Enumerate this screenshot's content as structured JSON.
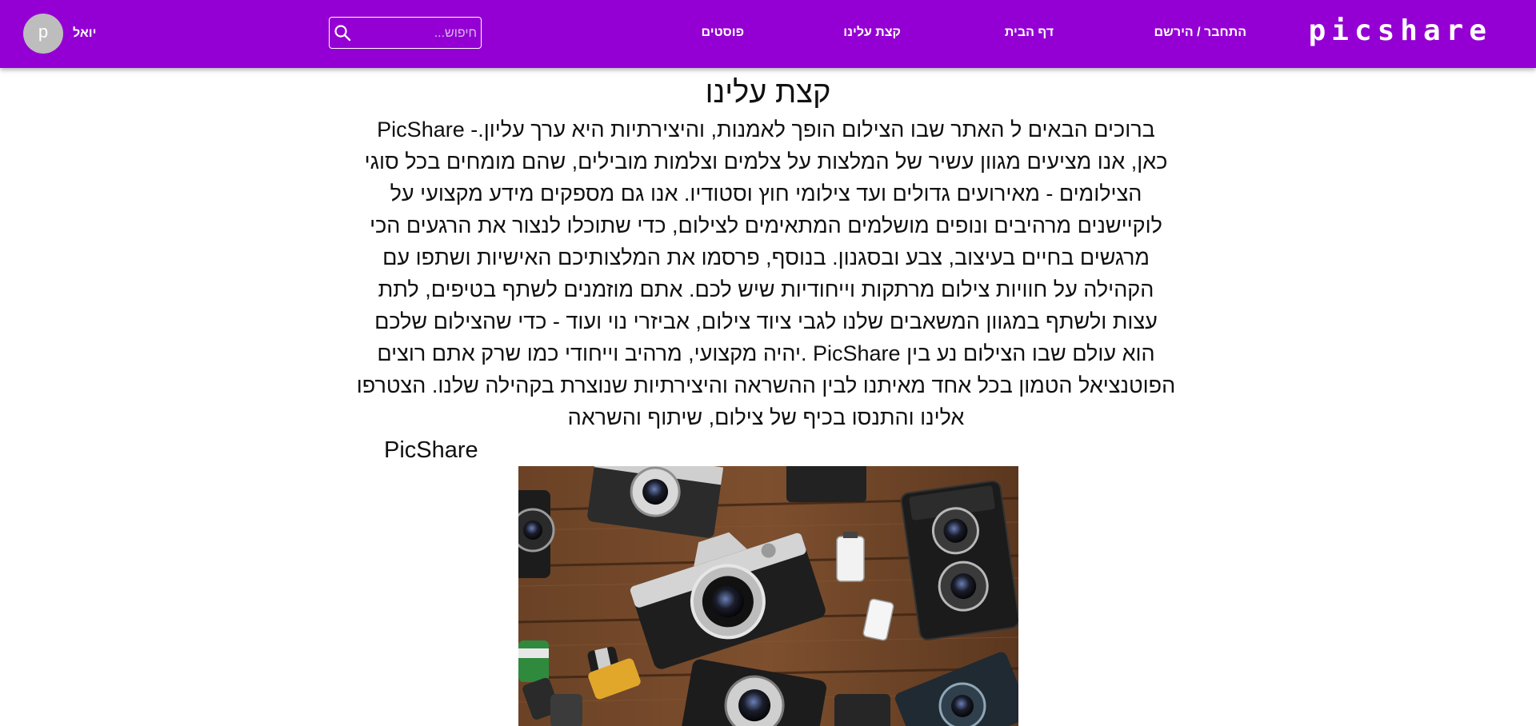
{
  "navbar": {
    "brand": "picshare",
    "links": {
      "login": "התחבר / הירשם",
      "home": "דף הבית",
      "about": "קצת עלינו",
      "posts": "פוסטים"
    },
    "search": {
      "placeholder": "חיפוש...",
      "icon": "search-icon"
    },
    "user": {
      "avatar_letter": "p",
      "name": "יואל"
    },
    "colors": {
      "background": "#9400d3",
      "text": "#ffffff"
    }
  },
  "main": {
    "title": "קצת עלינו",
    "paragraph": "ברוכים הבאים ל האתר שבו הצילום הופך לאמנות, והיצירתיות היא ערך עליון.- PicShare כאן, אנו מציעים מגוון עשיר של המלצות על צלמים וצלמות מובילים, שהם מומחים בכל סוגי הצילומים - מאירועים גדולים ועד צילומי חוץ וסטודיו. אנו גם מספקים מידע מקצועי על לוקיישנים מרהיבים ונופים מושלמים המתאימים לצילום, כדי שתוכלו לנצור את הרגעים הכי מרגשים בחיים בעיצוב, צבע ובסגנון. בנוסף, פרסמו את המלצותיכם האישיות ושתפו עם הקהילה על חוויות צילום מרתקות וייחודיות שיש לכם. אתם מוזמנים לשתף בטיפים, לתת עצות ולשתף במגוון המשאבים שלנו לגבי ציוד צילום, אביזרי נוי ועוד - כדי שהצילום שלכם הוא עולם שבו הצילום נע בין PicShare .יהיה מקצועי, מרהיב וייחודי כמו שרק אתם רוצים הפוטנציאל הטמון בכל אחד מאיתנו לבין ההשראה והיצירתיות שנוצרת בקהילה שלנו. הצטרפו אלינו והתנסו בכיף של צילום, שיתוף והשראה",
    "signature": "PicShare",
    "image_subject": "vintage-cameras-on-wooden-table"
  }
}
